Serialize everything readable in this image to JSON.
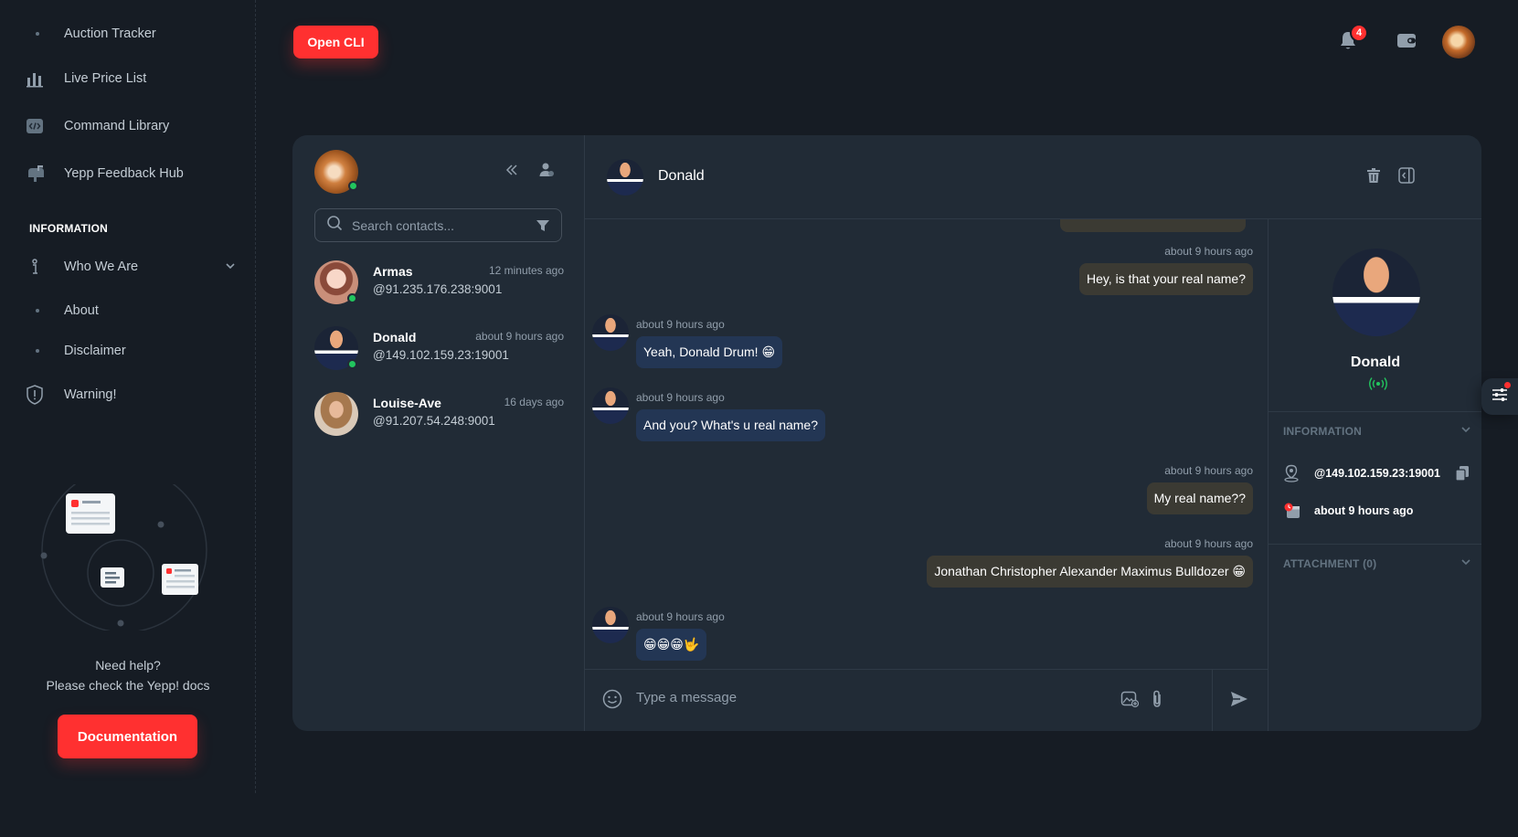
{
  "sidebar": {
    "items": [
      {
        "label": "Auction Tracker"
      },
      {
        "label": "Live Price List"
      },
      {
        "label": "Command Library"
      },
      {
        "label": "Yepp Feedback Hub"
      }
    ],
    "section_title": "INFORMATION",
    "info_items": [
      {
        "label": "Who We Are"
      },
      {
        "label": "About"
      },
      {
        "label": "Disclaimer"
      },
      {
        "label": "Warning!"
      }
    ],
    "help_line1": "Need help?",
    "help_line2": "Please check the Yepp! docs",
    "doc_button": "Documentation"
  },
  "topbar": {
    "open_cli": "Open CLI",
    "notification_count": "4"
  },
  "contacts": {
    "search_placeholder": "Search contacts...",
    "list": [
      {
        "name": "Armas",
        "address": "@91.235.176.238:9001",
        "time": "12 minutes ago",
        "online": true
      },
      {
        "name": "Donald",
        "address": "@149.102.159.23:19001",
        "time": "about 9 hours ago",
        "online": true
      },
      {
        "name": "Louise-Ave",
        "address": "@91.207.54.248:9001",
        "time": "16 days ago",
        "online": false
      }
    ]
  },
  "conversation": {
    "contact_name": "Donald",
    "messages": [
      {
        "direction": "out",
        "time": "about 9 hours ago",
        "text": "Hey, is that your real name?"
      },
      {
        "direction": "in",
        "time": "about 9 hours ago",
        "text": "Yeah, Donald Drum! 😁"
      },
      {
        "direction": "in",
        "time": "about 9 hours ago",
        "text": "And you? What's u real name?"
      },
      {
        "direction": "out",
        "time": "about 9 hours ago",
        "text": "My real name??"
      },
      {
        "direction": "out",
        "time": "about 9 hours ago",
        "text": "Jonathan Christopher Alexander Maximus Bulldozer 😁"
      },
      {
        "direction": "in",
        "time": "about 9 hours ago",
        "text": "😁😁😁🤟"
      }
    ],
    "compose_placeholder": "Type a message"
  },
  "details": {
    "name": "Donald",
    "information_title": "INFORMATION",
    "address": "@149.102.159.23:19001",
    "last_seen": "about 9 hours ago",
    "attachment_title": "ATTACHMENT (0)"
  },
  "colors": {
    "accent": "#ff3030",
    "online": "#22c55e",
    "incoming_bubble": "#233654",
    "outgoing_bubble": "#3b3a33"
  }
}
